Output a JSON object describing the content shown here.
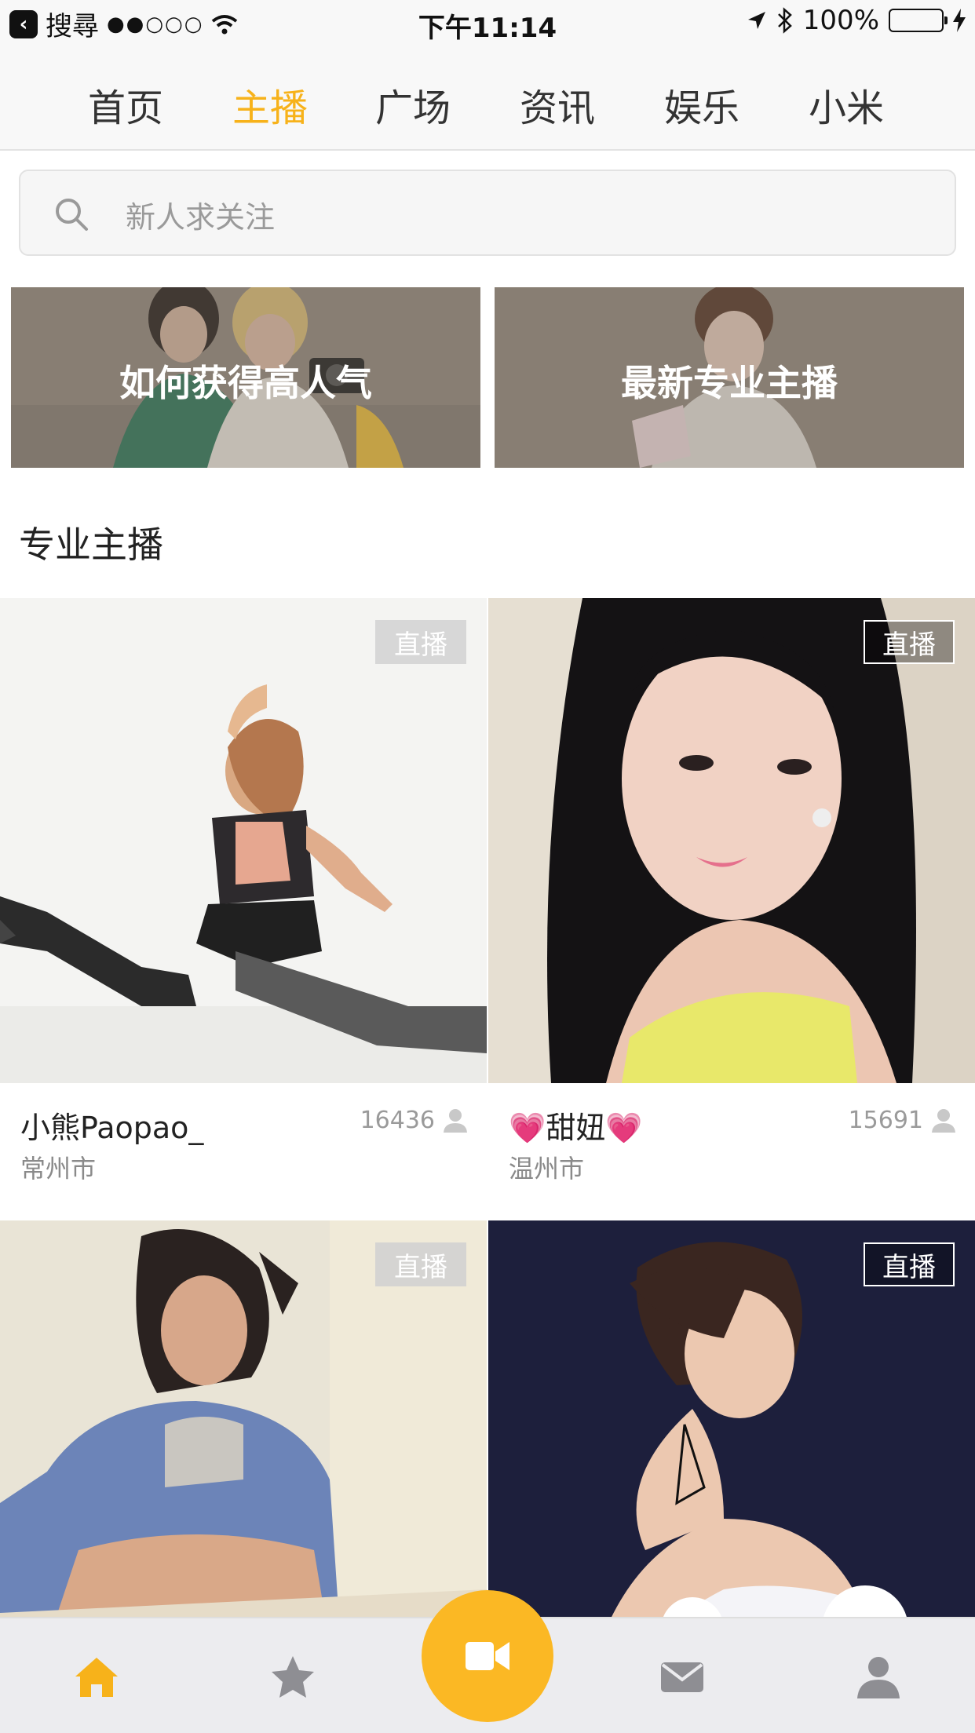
{
  "status_bar": {
    "back_app": "搜尋",
    "signal": "●●○○○",
    "time": "下午11:14",
    "battery": "100%"
  },
  "top_tabs": [
    {
      "label": "首页",
      "active": false
    },
    {
      "label": "主播",
      "active": true
    },
    {
      "label": "广场",
      "active": false
    },
    {
      "label": "资讯",
      "active": false
    },
    {
      "label": "娱乐",
      "active": false
    },
    {
      "label": "小米",
      "active": false
    }
  ],
  "search": {
    "placeholder": "新人求关注"
  },
  "banners": [
    {
      "label": "如何获得高人气"
    },
    {
      "label": "最新专业主播"
    }
  ],
  "section_title": "专业主播",
  "cards": [
    {
      "name": "小熊Paopao_",
      "city": "常州市",
      "count": "16436",
      "badge": "直播"
    },
    {
      "name": "💗甜妞💗",
      "city": "温州市",
      "count": "15691",
      "badge": "直播"
    },
    {
      "name": "",
      "city": "",
      "count": "",
      "badge": "直播"
    },
    {
      "name": "",
      "city": "",
      "count": "",
      "badge": "直播"
    }
  ],
  "tab_bar": {
    "items": [
      "home-icon",
      "star-icon",
      "video-camera-icon",
      "mail-icon",
      "user-icon"
    ],
    "accent_color": "#f7b21a",
    "inactive_color": "#8e8e93"
  }
}
